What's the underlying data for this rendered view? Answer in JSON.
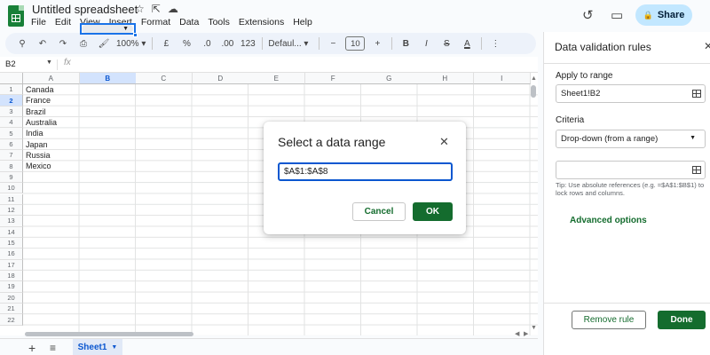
{
  "app": {
    "doc_title": "Untitled spreadsheet",
    "menu": [
      "File",
      "Edit",
      "View",
      "Insert",
      "Format",
      "Data",
      "Tools",
      "Extensions",
      "Help"
    ],
    "share_label": "Share",
    "accent": "#188038",
    "share_bg": "#c2e7ff"
  },
  "toolbar": {
    "zoom": "100%",
    "currency": "£",
    "percent": "%",
    "dec_decrease": ".0",
    "dec_increase": ".00",
    "number_format": "123",
    "font": "Defaul...",
    "font_size": "10",
    "bold": "B",
    "italic": "I",
    "strike": "S",
    "text_color": "A"
  },
  "formula": {
    "name_box": "B2",
    "fx": "fx"
  },
  "grid": {
    "columns": [
      "A",
      "B",
      "C",
      "D",
      "E",
      "F",
      "G",
      "H",
      "I"
    ],
    "active_column": "B",
    "rows": [
      "1",
      "2",
      "3",
      "4",
      "5",
      "6",
      "7",
      "8",
      "9",
      "10",
      "11",
      "12",
      "13",
      "14",
      "15",
      "16",
      "17",
      "18",
      "19",
      "20",
      "21",
      "22"
    ],
    "active_row": "2",
    "column_a": [
      "Canada",
      "France",
      "Brazil",
      "Australia",
      "India",
      "Japan",
      "Russia",
      "Mexico"
    ]
  },
  "sheets": {
    "tab_label": "Sheet1"
  },
  "panel": {
    "title": "Data validation rules",
    "apply_label": "Apply to range",
    "apply_value": "Sheet1!B2",
    "criteria_label": "Criteria",
    "criteria_value": "Drop-down (from a range)",
    "range_value": "",
    "tip": "Tip: Use absolute references (e.g. =$A$1:$B$1) to lock rows and columns.",
    "advanced": "Advanced options",
    "remove_rule": "Remove rule",
    "done": "Done",
    "button_color": "#146c2e"
  },
  "dialog": {
    "title": "Select a data range",
    "input_value": "$A$1:$A$8",
    "cancel": "Cancel",
    "ok": "OK"
  }
}
